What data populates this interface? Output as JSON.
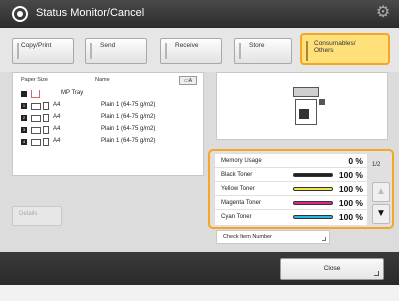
{
  "header": {
    "title": "Status Monitor/Cancel"
  },
  "tabs": [
    {
      "label": "Copy/Print"
    },
    {
      "label": "Send"
    },
    {
      "label": "Receive"
    },
    {
      "label": "Store"
    },
    {
      "label_line1": "Consumables/",
      "label_line2": "Others"
    }
  ],
  "job_list": {
    "col_paper_size": "Paper Size",
    "col_name": "Name",
    "rows": [
      {
        "num": "",
        "size": "MP Tray",
        "name": ""
      },
      {
        "num": "1",
        "size": "A4",
        "name": "Plain 1 (64-75 g/m2)"
      },
      {
        "num": "2",
        "size": "A4",
        "name": "Plain 1 (64-75 g/m2)"
      },
      {
        "num": "3",
        "size": "A4",
        "name": "Plain 1 (64-75 g/m2)"
      },
      {
        "num": "4",
        "size": "A4",
        "name": "Plain 1 (64-75 g/m2)"
      }
    ]
  },
  "details_button": "Details",
  "consumables": {
    "rows": [
      {
        "label": "Memory Usage",
        "value": "0 %"
      },
      {
        "label": "Black Toner",
        "value": "100 %",
        "color": "#222222",
        "level": 1.0
      },
      {
        "label": "Yellow Toner",
        "value": "100 %",
        "color": "#f2e84a",
        "level": 1.0
      },
      {
        "label": "Magenta Toner",
        "value": "100 %",
        "color": "#e0278b",
        "level": 1.0
      },
      {
        "label": "Cyan Toner",
        "value": "100 %",
        "color": "#29b6e8",
        "level": 1.0
      }
    ],
    "pager": "1/2"
  },
  "check_item_number": "Check Item Number",
  "close_button": "Close",
  "accent_color": "#f5a623"
}
